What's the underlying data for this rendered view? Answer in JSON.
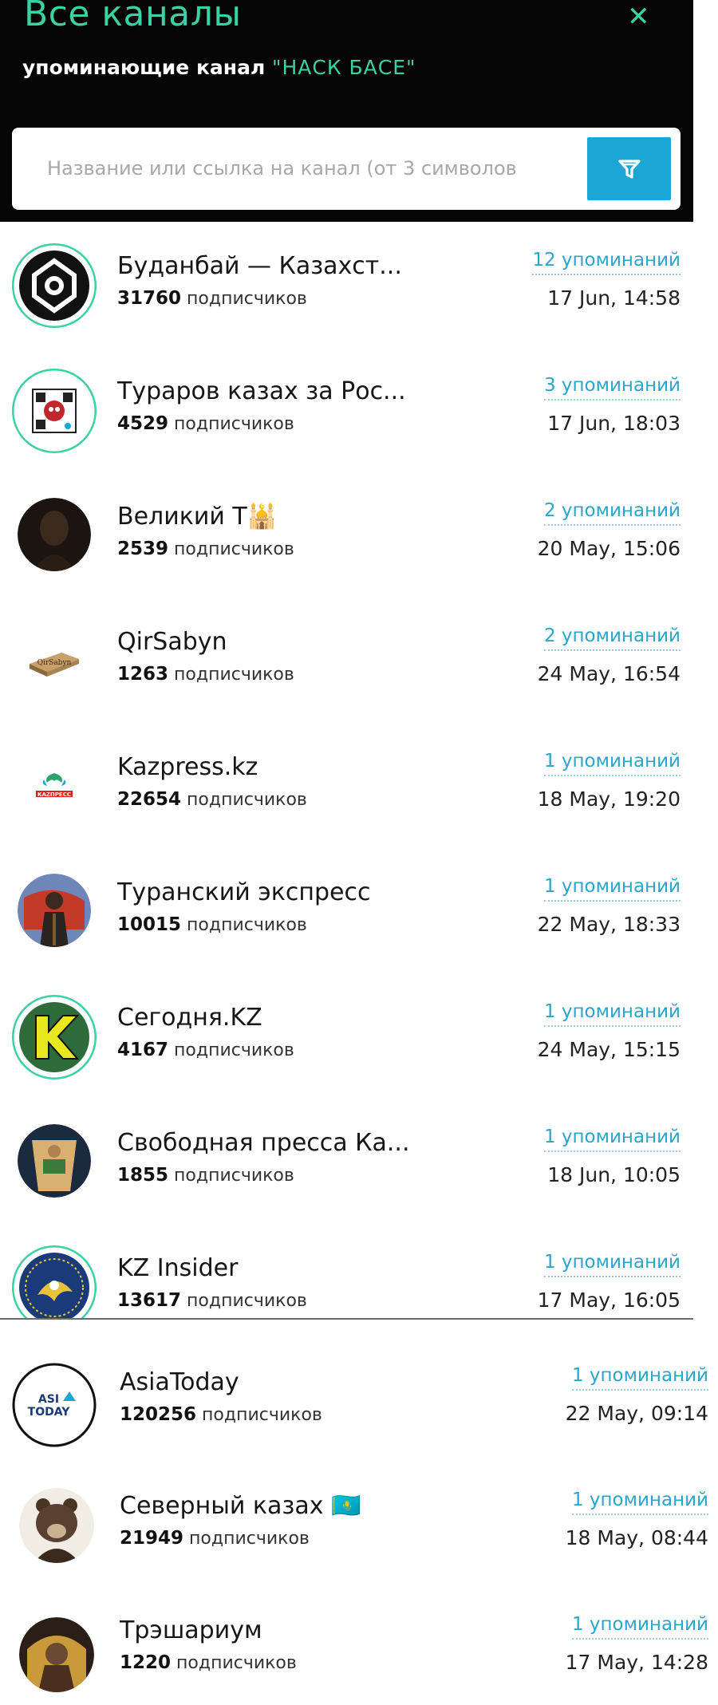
{
  "header": {
    "title": "Все каналы",
    "subtitle_prefix": "упоминающие канал",
    "subtitle_channel": "\"НАСК БАСЕ\"",
    "close_icon": "close-icon"
  },
  "search": {
    "placeholder": "Название или ссылка на канал (от 3 символов",
    "value": "",
    "filter_icon": "filter-icon"
  },
  "subs_suffix": "подписчиков",
  "channels": [
    {
      "name": "Буданбай — Казахст...",
      "subscribers": "31760",
      "mentions": "12 упоминаний",
      "date": "17 Jun, 14:58"
    },
    {
      "name": "Тураров казах за Рос...",
      "subscribers": "4529",
      "mentions": "3 упоминаний",
      "date": "17 Jun, 18:03"
    },
    {
      "name": "Великий Т🕌",
      "subscribers": "2539",
      "mentions": "2 упоминаний",
      "date": "20 May, 15:06"
    },
    {
      "name": "QirSabyn",
      "subscribers": "1263",
      "mentions": "2 упоминаний",
      "date": "24 May, 16:54"
    },
    {
      "name": "Kazpress.kz",
      "subscribers": "22654",
      "mentions": "1 упоминаний",
      "date": "18 May, 19:20"
    },
    {
      "name": "Туранский экспресс",
      "subscribers": "10015",
      "mentions": "1 упоминаний",
      "date": "22 May, 18:33"
    },
    {
      "name": "Сегодня.KZ",
      "subscribers": "4167",
      "mentions": "1 упоминаний",
      "date": "24 May, 15:15"
    },
    {
      "name": "Свободная пресса Ка...",
      "subscribers": "1855",
      "mentions": "1 упоминаний",
      "date": "18 Jun, 10:05"
    },
    {
      "name": "KZ Insider",
      "subscribers": "13617",
      "mentions": "1 упоминаний",
      "date": "17 May, 16:05"
    },
    {
      "name": "AsiaToday",
      "subscribers": "120256",
      "mentions": "1 упоминаний",
      "date": "22 May, 09:14",
      "logo_text": "ASIA TODAY"
    },
    {
      "name": "Северный казах 🇰🇿",
      "subscribers": "21949",
      "mentions": "1 упоминаний",
      "date": "18 May, 08:44"
    },
    {
      "name": "Трэшариум",
      "subscribers": "1220",
      "mentions": "1 упоминаний",
      "date": "17 May, 14:28"
    }
  ],
  "colors": {
    "accent": "#3ad1a4",
    "link": "#2aa6c9",
    "button": "#1ba6d6",
    "header_bg": "#050505"
  }
}
